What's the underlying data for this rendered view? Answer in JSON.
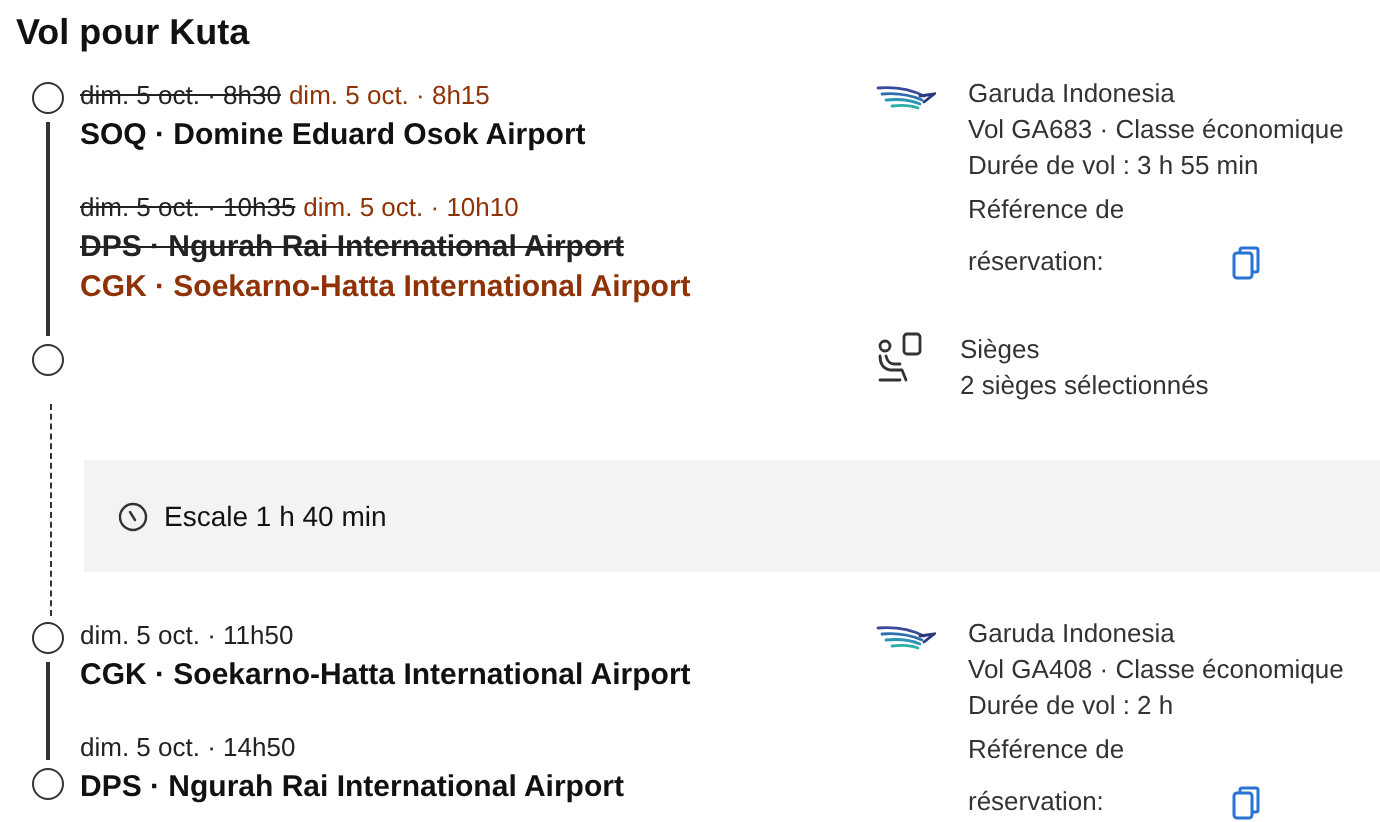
{
  "title": "Vol pour Kuta",
  "itinerary": [
    {
      "kind": "segment",
      "departure": {
        "old_time": "dim. 5 oct. · 8h30",
        "time": "dim. 5 oct. · 8h15",
        "airport": "SOQ · Domine Eduard Osok Airport"
      },
      "arrival": {
        "old_time": "dim. 5 oct. · 10h35",
        "time": "dim. 5 oct. · 10h10",
        "old_airport": "DPS · Ngurah Rai International Airport",
        "airport": "CGK · Soekarno-Hatta International Airport"
      },
      "airline": "Garuda Indonesia",
      "flight": "Vol GA683 · Classe économique",
      "duration": "Durée de vol : 3 h 55 min",
      "reference_label": "Référence de réservation:",
      "seats": {
        "label": "Sièges",
        "value": "2 sièges sélectionnés"
      }
    },
    {
      "kind": "layover",
      "text": "Escale 1 h 40 min"
    },
    {
      "kind": "segment",
      "departure": {
        "time": "dim. 5 oct. · 11h50",
        "airport": "CGK · Soekarno-Hatta International Airport"
      },
      "arrival": {
        "time": "dim. 5 oct. · 14h50",
        "airport": "DPS · Ngurah Rai International Airport"
      },
      "airline": "Garuda Indonesia",
      "flight": "Vol GA408 · Classe économique",
      "duration": "Durée de vol : 2 h",
      "reference_label": "Référence de réservation:"
    }
  ]
}
